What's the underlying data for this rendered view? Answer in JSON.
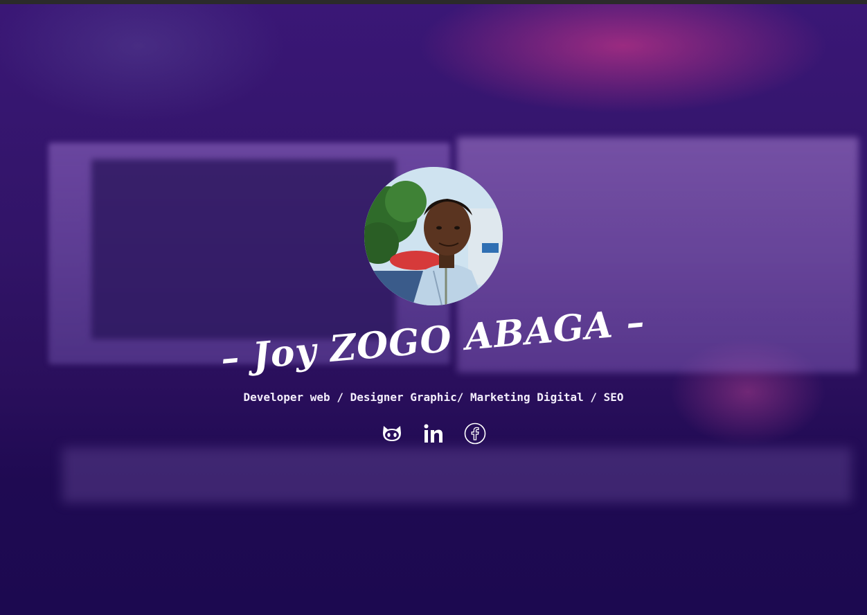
{
  "hero": {
    "name": "– Joy ZOGO ABAGA –",
    "tagline": "Developer web / Designer Graphic/ Marketing Digital / SEO"
  },
  "socials": [
    {
      "icon": "github-icon",
      "label": "GitHub"
    },
    {
      "icon": "linkedin-icon",
      "label": "LinkedIn"
    },
    {
      "icon": "facebook-icon",
      "label": "Facebook"
    }
  ],
  "colors": {
    "overlay": "#2a0f5c",
    "text": "#ffffff"
  }
}
